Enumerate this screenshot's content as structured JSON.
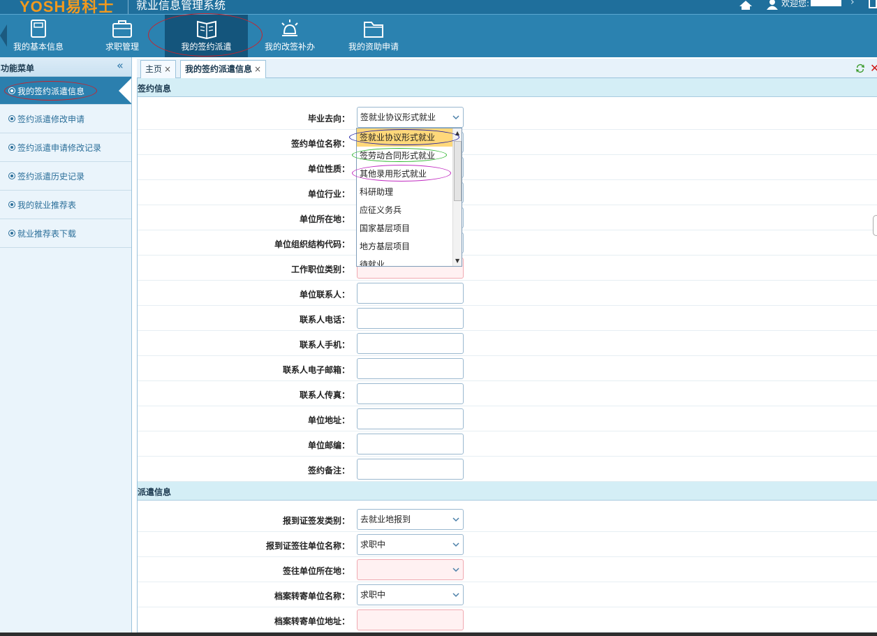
{
  "header": {
    "logo": "YOSH易科士",
    "system_title": "就业信息管理系统",
    "welcome": "欢迎您:",
    "user_name": ""
  },
  "nav": {
    "items": [
      {
        "label": "我的基本信息",
        "icon": "book-icon"
      },
      {
        "label": "求职管理",
        "icon": "briefcase-icon"
      },
      {
        "label": "我的签约派遣",
        "icon": "open-book-icon",
        "active": true
      },
      {
        "label": "我的改签补办",
        "icon": "alarm-light-icon"
      },
      {
        "label": "我的资助申请",
        "icon": "folder-icon"
      }
    ]
  },
  "sidebar": {
    "title": "功能菜单",
    "items": [
      {
        "label": "我的签约派遣信息",
        "active": true
      },
      {
        "label": "签约派遣修改申请"
      },
      {
        "label": "签约派遣申请修改记录"
      },
      {
        "label": "签约派遣历史记录"
      },
      {
        "label": "我的就业推荐表"
      },
      {
        "label": "就业推荐表下载"
      }
    ]
  },
  "tabs": [
    {
      "label": "主页"
    },
    {
      "label": "我的签约派遣信息",
      "active": true
    }
  ],
  "sign_section": {
    "title": "签约信息",
    "fields": [
      {
        "label": "毕业去向：",
        "value": "签就业协议形式就业",
        "type": "select"
      },
      {
        "label": "签约单位名称：",
        "value": ""
      },
      {
        "label": "单位性质：",
        "value": ""
      },
      {
        "label": "单位行业：",
        "value": ""
      },
      {
        "label": "单位所在地：",
        "value": ""
      },
      {
        "label": "单位组织结构代码：",
        "value": ""
      },
      {
        "label": "工作职位类别：",
        "value": ""
      },
      {
        "label": "单位联系人：",
        "value": ""
      },
      {
        "label": "联系人电话：",
        "value": ""
      },
      {
        "label": "联系人手机：",
        "value": ""
      },
      {
        "label": "联系人电子邮箱：",
        "value": ""
      },
      {
        "label": "联系人传真：",
        "value": ""
      },
      {
        "label": "单位地址：",
        "value": ""
      },
      {
        "label": "单位邮编：",
        "value": ""
      },
      {
        "label": "签约备注：",
        "value": ""
      }
    ]
  },
  "dropdown": {
    "options": [
      "签就业协议形式就业",
      "签劳动合同形式就业",
      "其他录用形式就业",
      "科研助理",
      "应征义务兵",
      "国家基层项目",
      "地方基层项目",
      "待就业"
    ],
    "highlight_color": "#ffd87a"
  },
  "dispatch_section": {
    "title": "派遣信息",
    "fields": [
      {
        "label": "报到证签发类别：",
        "value": "去就业地报到",
        "type": "select"
      },
      {
        "label": "报到证签往单位名称：",
        "value": "求职中",
        "type": "select"
      },
      {
        "label": "签往单位所在地：",
        "value": "",
        "type": "select",
        "required": true
      },
      {
        "label": "档案转寄单位名称：",
        "value": "求职中",
        "type": "select"
      },
      {
        "label": "档案转寄单位地址：",
        "value": "",
        "required": true
      }
    ]
  },
  "colors": {
    "topbar": "#1f6f9c",
    "navbar": "#2b82b0",
    "nav_active": "#14557c",
    "section_head": "#d4eef6",
    "required_bg": "#fff1f2",
    "annotation_red": "#c8232c"
  }
}
